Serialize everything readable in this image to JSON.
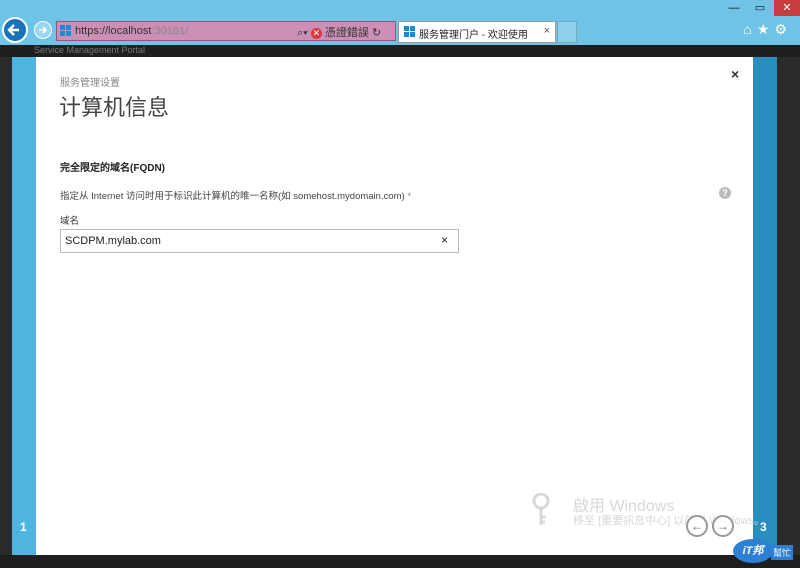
{
  "browser": {
    "url_host": "https://localhost",
    "url_rest": ":30101/",
    "cert_error_label": "憑證錯誤",
    "tab_title": "服务管理门户 - 欢迎使用",
    "tab_close": "×",
    "window_controls": {
      "minimize": "—",
      "restore": "▭",
      "close": "✕"
    },
    "toolbar_icons": [
      "home-icon",
      "star-icon",
      "gear-icon"
    ]
  },
  "portal": {
    "name": "Service Management Portal"
  },
  "dialog": {
    "breadcrumb": "服务管理设置",
    "title": "计算机信息",
    "close_label": "×",
    "section_heading": "完全限定的域名(FQDN)",
    "description": "指定从 Internet 访问时用于标识此计算机的唯一名称(如 somehost.mydomain.com)",
    "required_marker": "*",
    "help_label": "?",
    "field_label": "域名",
    "domain_value": "SCDPM.mylab.com",
    "clear_label": "×",
    "step_current": "1",
    "step_total": "3",
    "prev_label": "←",
    "next_label": "→"
  },
  "watermark": {
    "title": "啟用 Windows",
    "subtitle": "移至 [重要訊息中心] 以啟用 Windows。"
  },
  "site_badge": {
    "logo": "iT邦",
    "text": "幫忙"
  },
  "colors": {
    "chrome": "#6fc3e6",
    "left_rail": "#4fb4e0",
    "right_rail": "#2a8dc0",
    "address_bar_error": "#cc8fb6"
  }
}
